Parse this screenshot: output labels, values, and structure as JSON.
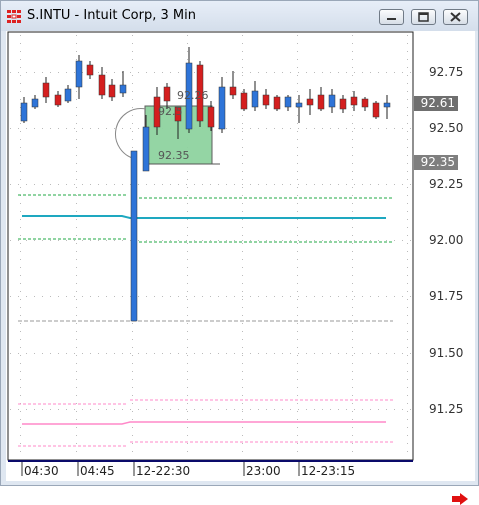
{
  "window": {
    "title": "S.INTU - Intuit Corp, 3 Min",
    "icon": "app-grid-icon",
    "buttons": [
      "minimize-icon",
      "restore-icon",
      "close-icon"
    ]
  },
  "price_axis": {
    "labels": [
      "92.75",
      "92.50",
      "92.25",
      "92.00",
      "91.75",
      "91.50",
      "91.25"
    ],
    "last_price": "92.61",
    "order_price": "92.35"
  },
  "time_axis": {
    "labels": [
      "04:30",
      "04:45",
      "12-22:30",
      "23:00",
      "12-23:15"
    ]
  },
  "order_box": {
    "price_label": "92.35",
    "top_label": "92.26",
    "side_label": "92.5"
  },
  "colors": {
    "up": "#2e74d8",
    "down": "#d41f1f",
    "order_box": "#8fd3a0",
    "band_green": "#22aa44",
    "band_pink": "#ff88c8",
    "mean_line": "#1ea8c0",
    "nav_arrow": "#e01010"
  }
}
